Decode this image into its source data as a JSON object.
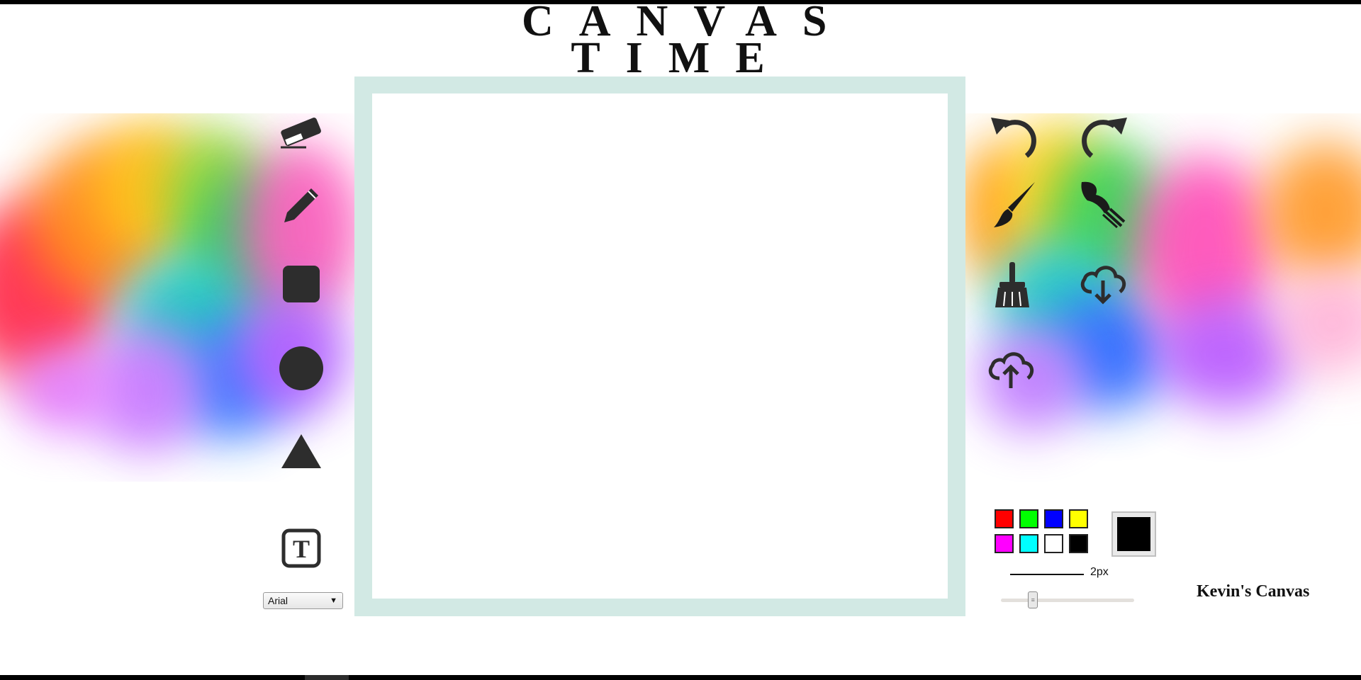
{
  "title": {
    "line1": "CANVAS",
    "line2": "TIME"
  },
  "left_tools": [
    {
      "icon": "eraser-icon"
    },
    {
      "icon": "pencil-icon"
    },
    {
      "icon": "square-icon"
    },
    {
      "icon": "circle-icon"
    },
    {
      "icon": "triangle-icon"
    },
    {
      "icon": "text-tool-icon"
    }
  ],
  "font_select": {
    "selected": "Arial"
  },
  "right_tools": [
    {
      "icon": "undo-icon"
    },
    {
      "icon": "redo-icon"
    },
    {
      "icon": "brush-icon"
    },
    {
      "icon": "paint-brush-icon"
    },
    {
      "icon": "broom-icon"
    },
    {
      "icon": "cloud-download-icon"
    },
    {
      "icon": "cloud-upload-icon"
    }
  ],
  "palette": [
    "#ff0000",
    "#00ff00",
    "#0000ff",
    "#ffff00",
    "#ff00ff",
    "#00ffff",
    "#ffffff",
    "#000000"
  ],
  "current_color": "#000000",
  "stroke": {
    "label": "2px",
    "slider_fraction": 0.22
  },
  "signature": "Kevin's Canvas",
  "canvas": {
    "frame_color": "#d2e9e4",
    "surface_color": "#ffffff"
  }
}
